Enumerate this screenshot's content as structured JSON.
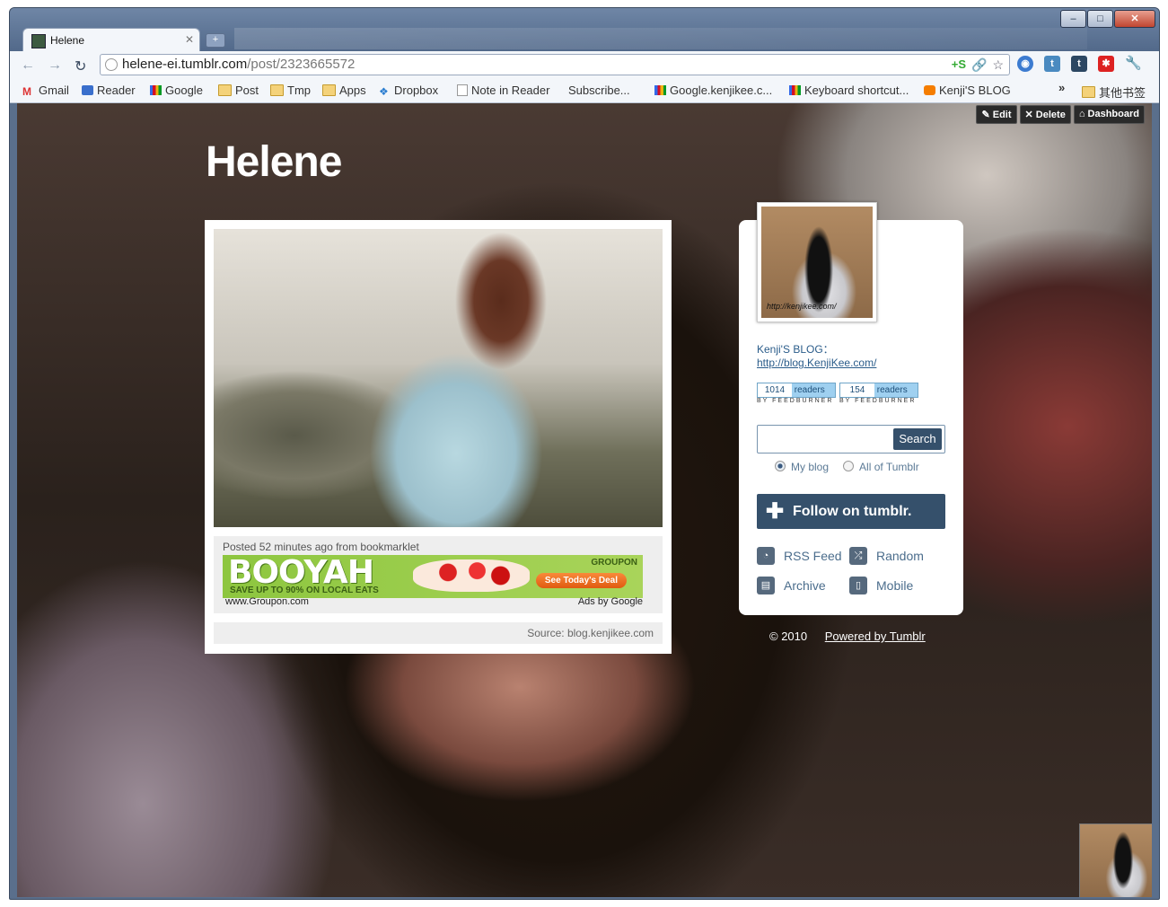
{
  "browser": {
    "tab_title": "Helene",
    "url_host": "helene-ei.tumblr.com",
    "url_path": "/post/2323665572",
    "new_tab": "+",
    "window_controls": [
      "–",
      "□",
      "✕"
    ]
  },
  "bookmarks": [
    {
      "label": "Gmail",
      "icon": "gmail-icon"
    },
    {
      "label": "Reader",
      "icon": "reader-icon"
    },
    {
      "label": "Google",
      "icon": "google-icon"
    },
    {
      "label": "Post",
      "icon": "folder-icon"
    },
    {
      "label": "Tmp",
      "icon": "folder-icon"
    },
    {
      "label": "Apps",
      "icon": "folder-icon"
    },
    {
      "label": "Dropbox",
      "icon": "dropbox-icon"
    },
    {
      "label": "Note in Reader",
      "icon": "page-icon"
    },
    {
      "label": "Subscribe...",
      "icon": "page-icon"
    },
    {
      "label": "Google.kenjikee.c...",
      "icon": "google-icon"
    },
    {
      "label": "Keyboard shortcut...",
      "icon": "google-icon"
    },
    {
      "label": "Kenji'S BLOG",
      "icon": "blogger-icon"
    }
  ],
  "bookmarks_overflow": "»",
  "other_bookmarks": "其他书签",
  "admin": {
    "edit": "Edit",
    "delete": "Delete",
    "dashboard": "Dashboard"
  },
  "blog": {
    "title": "Helene"
  },
  "post": {
    "posted": "Posted 52 minutes ago from bookmarklet",
    "source": "Source: blog.kenjikee.com"
  },
  "ad": {
    "headline": "BOOYAH",
    "sub": "SAVE UP TO 90% ON LOCAL EATS",
    "brand": "GROUPON",
    "cta": "See Today's Deal",
    "display_url": "www.Groupon.com",
    "ads_by": "Ads by Google"
  },
  "sidebar": {
    "avatar_watermark": "http://kenjikee.com/",
    "description_line1": "Kenji'S BLOG：",
    "description_link": "http://blog.KenjiKee.com/",
    "feedburner": [
      {
        "count": "1014",
        "label": "readers",
        "by": "BY FEEDBURNER"
      },
      {
        "count": "154",
        "label": "readers",
        "by": "BY FEEDBURNER"
      }
    ],
    "search_button": "Search",
    "radio_my_blog": "My blog",
    "radio_all": "All of Tumblr",
    "follow": "Follow on tumblr.",
    "links": {
      "rss": "RSS Feed",
      "random": "Random",
      "archive": "Archive",
      "mobile": "Mobile"
    }
  },
  "footer": {
    "copyright": "© 2010",
    "powered": "Powered by Tumblr"
  }
}
